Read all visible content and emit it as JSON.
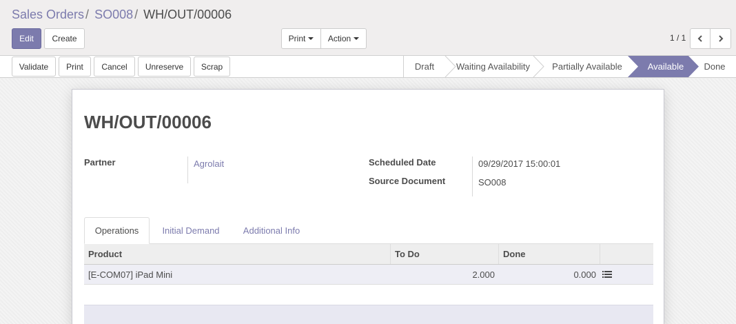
{
  "breadcrumb": {
    "items": [
      "Sales Orders",
      "SO008"
    ],
    "separator": "/",
    "current": "WH/OUT/00006"
  },
  "buttons": {
    "edit": "Edit",
    "create": "Create",
    "print": "Print",
    "action": "Action"
  },
  "pager": {
    "value": "1 / 1",
    "prev_icon": "chevron-left-icon",
    "next_icon": "chevron-right-icon"
  },
  "statusbar": {
    "buttons": {
      "validate": "Validate",
      "print": "Print",
      "cancel": "Cancel",
      "unreserve": "Unreserve",
      "scrap": "Scrap"
    },
    "stages": [
      "Draft",
      "Waiting Availability",
      "Partially Available",
      "Available",
      "Done"
    ],
    "active_stage": "Available"
  },
  "form": {
    "title": "WH/OUT/00006",
    "partner_label": "Partner",
    "partner_value": "Agrolait",
    "scheduled_date_label": "Scheduled Date",
    "scheduled_date_value": "09/29/2017 15:00:01",
    "source_document_label": "Source Document",
    "source_document_value": "SO008"
  },
  "tabs": [
    "Operations",
    "Initial Demand",
    "Additional Info"
  ],
  "active_tab": "Operations",
  "table": {
    "columns": [
      "Product",
      "To Do",
      "Done"
    ],
    "rows": [
      {
        "product": "[E-COM07] iPad Mini",
        "todo": "2.000",
        "done": "0.000",
        "detail_icon": "list-icon"
      }
    ]
  },
  "colors": {
    "primary": "#7c7bad",
    "active_stage_bg": "#7c7bad"
  }
}
